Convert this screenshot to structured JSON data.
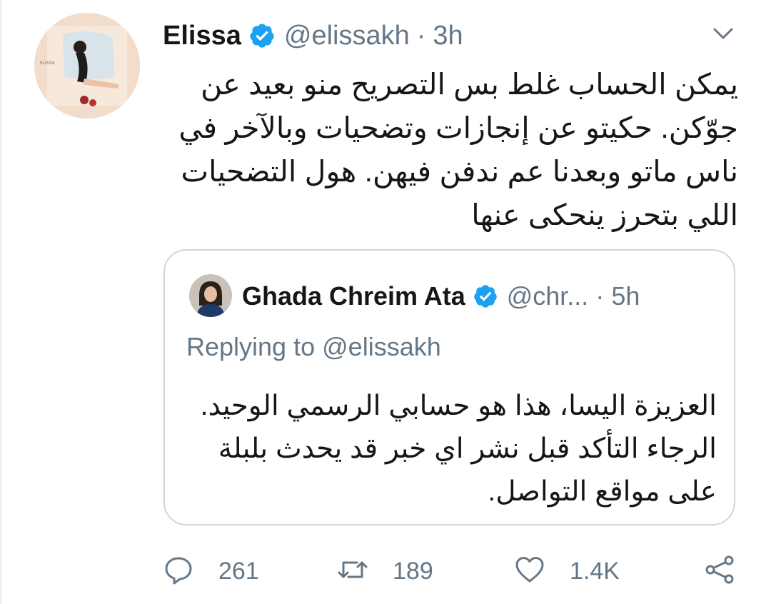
{
  "tweet": {
    "author_name": "Elissa",
    "handle": "@elissakh",
    "separator": "·",
    "time": "3h",
    "avatar_text": "ELISSA",
    "text_lines": [
      "يمكن الحساب غلط بس التصريح منو بعيد عن",
      "جوّكن. حكيتو عن إنجازات وتضحيات وبالآخر في",
      "ناس ماتو وبعدنا عم ندفن فيهن. هول التضحيات",
      "اللي بتحرز ينحكى عنها"
    ]
  },
  "quoted": {
    "author_name": "Ghada Chreim Ata",
    "handle": "@chr...",
    "separator": "·",
    "time": "5h",
    "replying_prefix": "Replying to",
    "replying_to": "@elissakh",
    "text_lines": [
      "العزيزة اليسا، هذا هو حسابي الرسمي الوحيد.",
      "الرجاء التأكد قبل نشر اي خبر قد يحدث بلبلة",
      "على مواقع التواصل."
    ]
  },
  "actions": {
    "replies": "261",
    "retweets": "189",
    "likes": "1.4K"
  },
  "icons": {
    "verified": "verified-badge-icon",
    "menu": "chevron-down-icon",
    "reply": "reply-icon",
    "retweet": "retweet-icon",
    "like": "heart-icon",
    "share": "share-icon"
  },
  "colors": {
    "verified": "#1da1f2",
    "secondary_text": "#657786",
    "border": "#ccd6dd"
  }
}
